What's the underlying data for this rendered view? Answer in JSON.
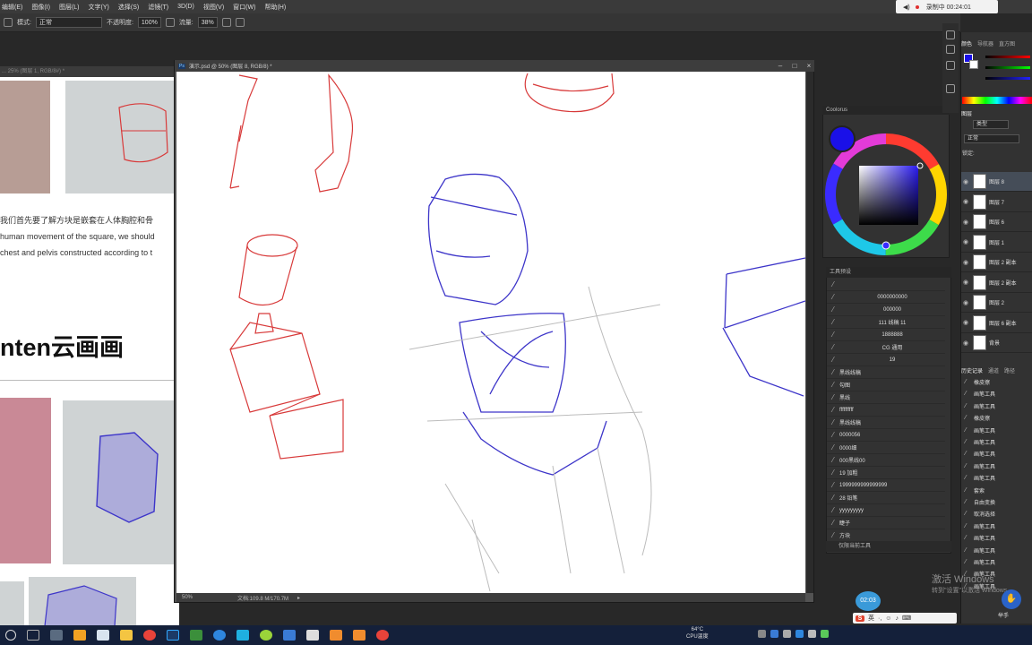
{
  "menubar": {
    "items": [
      "编辑(E)",
      "图像(I)",
      "图层(L)",
      "文字(Y)",
      "选择(S)",
      "滤镜(T)",
      "3D(D)",
      "视图(V)",
      "窗口(W)",
      "帮助(H)"
    ]
  },
  "recorder": {
    "status": "录制中 00:24:01"
  },
  "options_bar": {
    "mode_label": "模式:",
    "mode_value": "正常",
    "opacity_label": "不透明度:",
    "opacity_value": "100%",
    "flow_label": "流量:",
    "flow_value": "38%"
  },
  "reference_doc": {
    "title": "... 25% (图层 1, RGB/8#) *",
    "line1": "我们首先要了解方块是嵌套在人体胸腔和骨",
    "line2": "human movement of the square, we should",
    "line3": "chest and pelvis constructed according to t",
    "brand": "nten云画画"
  },
  "document": {
    "title": "演示.psd @ 50% (图层 8, RGB/8) *",
    "zoom": "50%",
    "doc_size": "文档:109.8 M/170.7M"
  },
  "coolorus": {
    "title": "Coolorus",
    "primary_color": "#1a10e8"
  },
  "presets": {
    "title": "工具预设",
    "items": [
      "",
      "0000000000",
      "000000",
      "111 线稿 11",
      "1888888",
      "CG 通用",
      "19",
      "黑线线稿",
      "勾图",
      "黑线",
      "ffffffffff",
      "黑线线稿",
      "0000056",
      "0000细",
      "000黑线00",
      "19 加粗",
      "1999999999999999",
      "28 铅笔",
      "yyyyyyyyy",
      "睫子",
      "方块"
    ],
    "footer": "仅限当前工具"
  },
  "right_panel": {
    "color_tabs": [
      "颜色",
      "导航器",
      "直方图"
    ],
    "layer_tab": "图层",
    "layer_kind": "类型",
    "blend_mode": "正常",
    "lock_label": "锁定:",
    "layers": [
      "图层 8",
      "图层 7",
      "图层 6",
      "图层 1",
      "图层 2 副本",
      "图层 2 副本",
      "图层 2",
      "图层 6 副本",
      "背景"
    ],
    "history_tabs": [
      "历史记录",
      "通道",
      "路径"
    ],
    "history": [
      "橡皮擦",
      "画笔工具",
      "画笔工具",
      "橡皮擦",
      "画笔工具",
      "画笔工具",
      "画笔工具",
      "画笔工具",
      "画笔工具",
      "套索",
      "自由变换",
      "取消选择",
      "画笔工具",
      "画笔工具",
      "画笔工具",
      "画笔工具",
      "画笔工具",
      "画笔工具"
    ]
  },
  "watermark": {
    "line1": "激活 Windows",
    "line2": "转到\"设置\"以激活 Windows。"
  },
  "taskbar": {
    "cpu_temp": "64°C",
    "cpu_label": "CPU温度",
    "timer": "02:03",
    "ime_label": "英",
    "hand_label": "举手"
  },
  "colors": {
    "accent": "#3a9ad9",
    "pencil_blue": "#3d35c9",
    "pencil_red": "#d83a3a"
  }
}
